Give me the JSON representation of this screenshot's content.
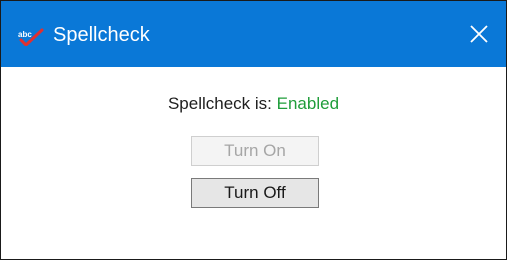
{
  "window": {
    "title": "Spellcheck",
    "app_icon": "spellcheck-abc-icon",
    "close_icon": "close-icon",
    "colors": {
      "titlebar": "#0a78d7",
      "status_enabled": "#1f9d3a"
    }
  },
  "status": {
    "label": "Spellcheck is:",
    "value": "Enabled"
  },
  "buttons": {
    "turn_on": {
      "label": "Turn On",
      "enabled": false
    },
    "turn_off": {
      "label": "Turn Off",
      "enabled": true
    }
  }
}
